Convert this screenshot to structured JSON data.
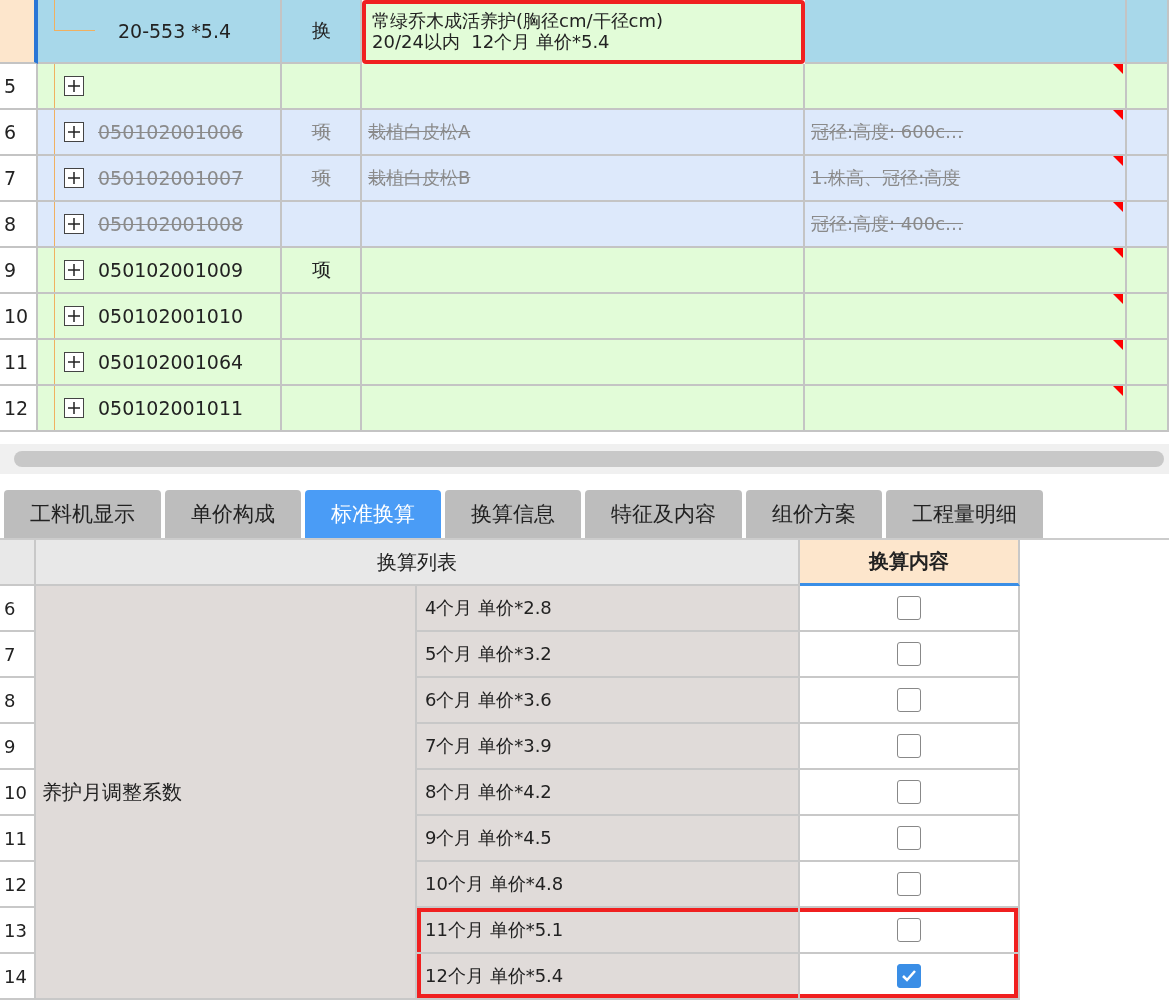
{
  "items_table": {
    "rows": [
      {
        "kind": "sub",
        "number": "",
        "code": "20-553 *5.4",
        "unit": "换",
        "name": "常绿乔木成活养护(胸径cm/干径cm)\n20/24以内  12个月 单价*5.4",
        "description": "",
        "selected": true,
        "struck": false,
        "highlighted": true,
        "has_note": false
      },
      {
        "kind": "item",
        "number": "5",
        "code": "",
        "unit": "",
        "name": "",
        "description": "",
        "selected": false,
        "struck": false,
        "highlighted": false,
        "has_note": true
      },
      {
        "kind": "item",
        "number": "6",
        "code": "050102001006",
        "unit": "项",
        "name": "栽植白皮松A",
        "description": "冠径:高度: 600c…",
        "selected": false,
        "struck": true,
        "highlighted": false,
        "has_note": true
      },
      {
        "kind": "item",
        "number": "7",
        "code": "050102001007",
        "unit": "项",
        "name": "栽植白皮松B",
        "description": "1.株高、冠径:高度",
        "selected": false,
        "struck": true,
        "highlighted": false,
        "has_note": true
      },
      {
        "kind": "item",
        "number": "8",
        "code": "050102001008",
        "unit": "",
        "name": "",
        "description": "冠径:高度: 400c…",
        "selected": false,
        "struck": true,
        "highlighted": false,
        "has_note": true
      },
      {
        "kind": "item",
        "number": "9",
        "code": "050102001009",
        "unit": "项",
        "name": "",
        "description": "",
        "selected": false,
        "struck": false,
        "highlighted": false,
        "has_note": true
      },
      {
        "kind": "item",
        "number": "10",
        "code": "050102001010",
        "unit": "",
        "name": "",
        "description": "",
        "selected": false,
        "struck": false,
        "highlighted": false,
        "has_note": true
      },
      {
        "kind": "item",
        "number": "11",
        "code": "050102001064",
        "unit": "",
        "name": "",
        "description": "",
        "selected": false,
        "struck": false,
        "highlighted": false,
        "has_note": true
      },
      {
        "kind": "item",
        "number": "12",
        "code": "050102001011",
        "unit": "",
        "name": "",
        "description": "",
        "selected": false,
        "struck": false,
        "highlighted": false,
        "has_note": true
      }
    ]
  },
  "tabs": [
    {
      "label": "工料机显示",
      "selected": false
    },
    {
      "label": "单价构成",
      "selected": false
    },
    {
      "label": "标准换算",
      "selected": true
    },
    {
      "label": "换算信息",
      "selected": false
    },
    {
      "label": "特征及内容",
      "selected": false
    },
    {
      "label": "组价方案",
      "selected": false
    },
    {
      "label": "工程量明细",
      "selected": false
    }
  ],
  "conversion_table": {
    "columns": [
      "换算列表",
      "换算内容"
    ],
    "group": "养护月调整系数",
    "rows": [
      {
        "number": "6",
        "option": "4个月 单价*2.8",
        "checked": false,
        "highlighted": false
      },
      {
        "number": "7",
        "option": "5个月 单价*3.2",
        "checked": false,
        "highlighted": false
      },
      {
        "number": "8",
        "option": "6个月 单价*3.6",
        "checked": false,
        "highlighted": false
      },
      {
        "number": "9",
        "option": "7个月 单价*3.9",
        "checked": false,
        "highlighted": false
      },
      {
        "number": "10",
        "option": "8个月 单价*4.2",
        "checked": false,
        "highlighted": false
      },
      {
        "number": "11",
        "option": "9个月 单价*4.5",
        "checked": false,
        "highlighted": false
      },
      {
        "number": "12",
        "option": "10个月 单价*4.8",
        "checked": false,
        "highlighted": false
      },
      {
        "number": "13",
        "option": "11个月 单价*5.1",
        "checked": false,
        "highlighted": true
      },
      {
        "number": "14",
        "option": "12个月 单价*5.4",
        "checked": true,
        "highlighted": true
      }
    ]
  }
}
